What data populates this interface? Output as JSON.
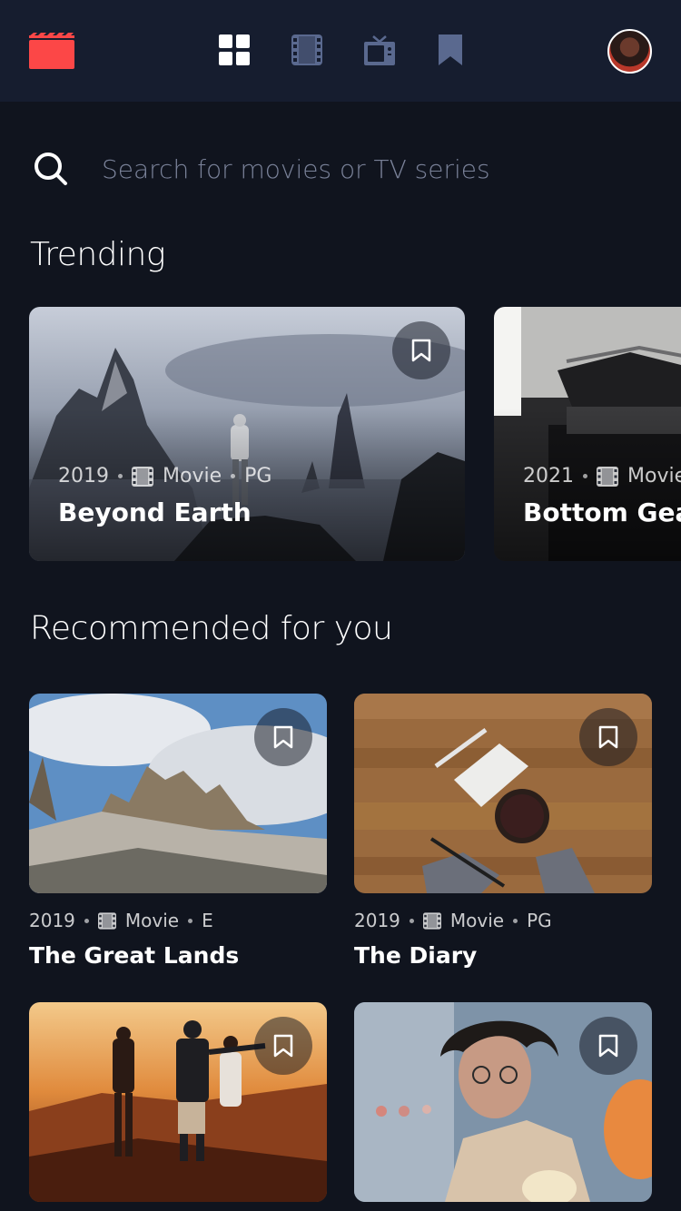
{
  "header": {
    "nav": [
      "home",
      "movies",
      "tv-series",
      "bookmarks"
    ],
    "active": "home",
    "accent": "#FC4747"
  },
  "search": {
    "placeholder": "Search for movies or TV series"
  },
  "trending": {
    "title": "Trending",
    "items": [
      {
        "year": "2019",
        "category": "Movie",
        "rating": "PG",
        "title": "Beyond Earth"
      },
      {
        "year": "2021",
        "category": "Movie",
        "rating": "",
        "title": "Bottom Gear"
      }
    ]
  },
  "recommended": {
    "title": "Recommended for you",
    "items": [
      {
        "year": "2019",
        "category": "Movie",
        "rating": "E",
        "title": "The Great Lands"
      },
      {
        "year": "2019",
        "category": "Movie",
        "rating": "PG",
        "title": "The Diary"
      },
      {
        "year": "",
        "category": "",
        "rating": "",
        "title": ""
      },
      {
        "year": "",
        "category": "",
        "rating": "",
        "title": ""
      }
    ]
  },
  "colors": {
    "background": "#10141E",
    "nav": "#161D2F",
    "muted_icon": "#5A698F"
  }
}
